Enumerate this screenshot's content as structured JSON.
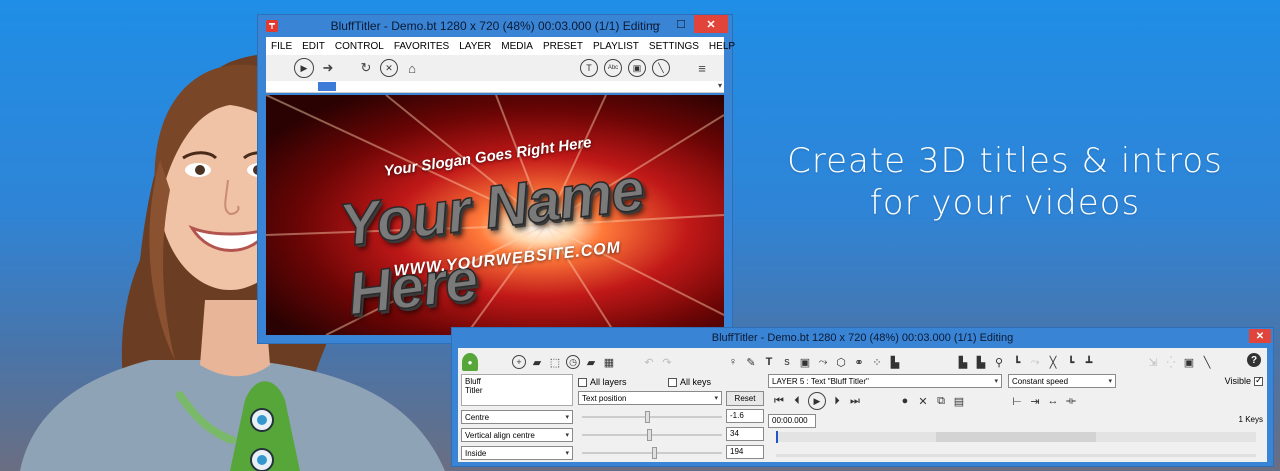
{
  "tagline": {
    "line1": "Create 3D titles & intros",
    "line2": "for your videos"
  },
  "main_window": {
    "title": "BluffTitler - Demo.bt 1280 x 720 (48%) 00:03.000 (1/1) Editing",
    "controls": {
      "minimize": "—",
      "maximize": "☐",
      "close": "✕"
    },
    "menu": [
      "FILE",
      "EDIT",
      "CONTROL",
      "FAVORITES",
      "LAYER",
      "MEDIA",
      "PRESET",
      "PLAYLIST",
      "SETTINGS",
      "HELP"
    ],
    "toolbar_icons": [
      "play-icon",
      "forward-icon",
      "refresh-icon",
      "stop-icon",
      "home-icon",
      "text-tool-icon",
      "abc-tool-icon",
      "image-tool-icon",
      "wand-tool-icon",
      "hamburger-menu-icon"
    ],
    "preview": {
      "slogan": "Your Slogan Goes Right Here",
      "name": "Your Name Here",
      "website": "WWW.YOURWEBSITE.COM",
      "colors": {
        "glow": "#ff7a3a",
        "deep_red": "#6b0505"
      }
    }
  },
  "editor_window": {
    "title": "BluffTitler - Demo.bt 1280 x 720 (48%) 00:03.000 (1/1) Editing",
    "close": "✕",
    "layer_list": [
      "Bluff",
      "Titler"
    ],
    "all_layers_label": "All layers",
    "all_keys_label": "All keys",
    "layer_select": "LAYER 5 : Text \"Bluff Titler\"",
    "speed_select": "Constant speed",
    "visible_label": "Visible",
    "property_select": "Text position",
    "reset_label": "Reset",
    "dropdowns": [
      "Centre",
      "Vertical align centre",
      "Inside"
    ],
    "values": [
      "-1.6",
      "34",
      "194"
    ],
    "time_value": "00:00.000",
    "keys_label": "1 Keys",
    "help": "?"
  }
}
